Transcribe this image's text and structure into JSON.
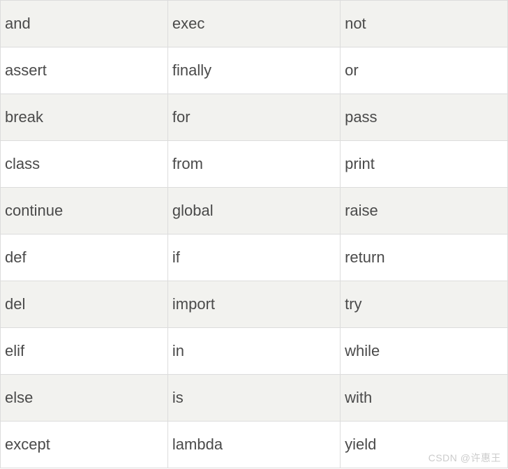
{
  "table": {
    "rows": [
      {
        "c0": "and",
        "c1": "exec",
        "c2": "not"
      },
      {
        "c0": "assert",
        "c1": "finally",
        "c2": "or"
      },
      {
        "c0": "break",
        "c1": "for",
        "c2": "pass"
      },
      {
        "c0": "class",
        "c1": "from",
        "c2": "print"
      },
      {
        "c0": "continue",
        "c1": "global",
        "c2": "raise"
      },
      {
        "c0": "def",
        "c1": "if",
        "c2": "return"
      },
      {
        "c0": "del",
        "c1": "import",
        "c2": "try"
      },
      {
        "c0": "elif",
        "c1": "in",
        "c2": "while"
      },
      {
        "c0": "else",
        "c1": "is",
        "c2": "with"
      },
      {
        "c0": "except",
        "c1": "lambda",
        "c2": "yield"
      }
    ]
  },
  "watermark": "CSDN @许惠王"
}
